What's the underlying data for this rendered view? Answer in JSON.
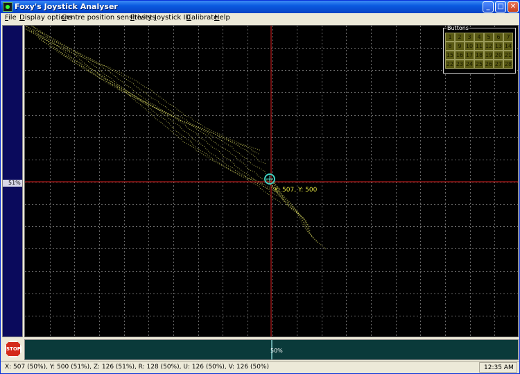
{
  "window": {
    "title": "Foxy's Joystick Analyser"
  },
  "title_buttons": {
    "min": "_",
    "max": "□",
    "close": "✕"
  },
  "menu": [
    "File",
    "Display options",
    "Centre position sensitivity",
    "Presets",
    "Joystick ID",
    "Calibrate",
    "Help"
  ],
  "y_axis": {
    "center_label": "51%"
  },
  "x_axis": {
    "center_label": "50%"
  },
  "crosshair": {
    "label": "X: 507, Y: 500"
  },
  "buttons_panel": {
    "title": "Buttons",
    "buttons": [
      "1",
      "2",
      "3",
      "4",
      "5",
      "6",
      "7",
      "8",
      "9",
      "10",
      "11",
      "12",
      "13",
      "14",
      "15",
      "16",
      "17",
      "18",
      "19",
      "20",
      "21",
      "22",
      "23",
      "24",
      "25",
      "26",
      "27",
      "28"
    ]
  },
  "stop_button": {
    "label": "STOP"
  },
  "status": {
    "text": "X: 507 (50%), Y: 500 (51%), Z: 126 (51%), R: 128 (50%), U: 126 (50%), V: 126 (50%)",
    "time": "12:35 AM"
  },
  "colors": {
    "grid": "#6a6a6a",
    "crosshair": "#e02020",
    "trail": "#d8d860",
    "cursor": "#40d0c0",
    "label": "#e0e040"
  },
  "icons": {
    "app": "joystick-app-icon",
    "cursor": "target-cursor-icon"
  }
}
